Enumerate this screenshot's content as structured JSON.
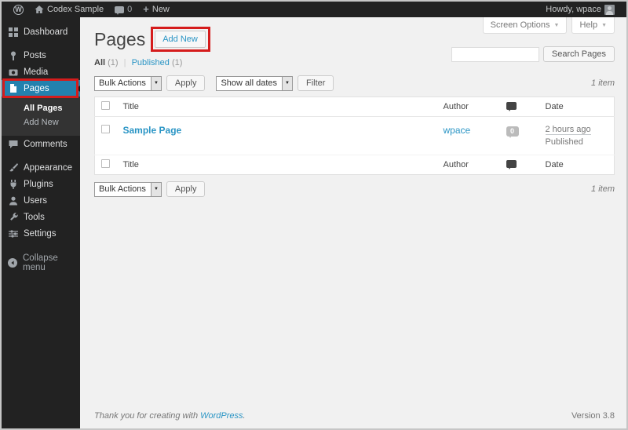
{
  "colors": {
    "accent_blue": "#2a95c5",
    "menu_active_bg": "#2381ae",
    "annotation_red": "#d51c1c",
    "admin_bar_bg": "#222222",
    "submenu_bg": "#333333",
    "content_bg": "#f1f1f1"
  },
  "admin_bar": {
    "site_name": "Codex Sample",
    "comment_count": "0",
    "new_label": "New",
    "greeting": "Howdy, wpace"
  },
  "sidebar": {
    "items": [
      {
        "label": "Dashboard"
      },
      {
        "label": "Posts"
      },
      {
        "label": "Media"
      },
      {
        "label": "Pages"
      },
      {
        "label": "Comments"
      },
      {
        "label": "Appearance"
      },
      {
        "label": "Plugins"
      },
      {
        "label": "Users"
      },
      {
        "label": "Tools"
      },
      {
        "label": "Settings"
      }
    ],
    "pages_submenu": {
      "all_pages": "All Pages",
      "add_new": "Add New"
    },
    "collapse_label": "Collapse menu"
  },
  "page_header": {
    "title": "Pages",
    "add_new_button": "Add New",
    "screen_options": "Screen Options",
    "help": "Help"
  },
  "filters": {
    "all": "All",
    "all_count": "(1)",
    "separator": "|",
    "published": "Published",
    "published_count": "(1)"
  },
  "search": {
    "value": "",
    "button": "Search Pages"
  },
  "toolbar_top": {
    "bulk_actions": "Bulk Actions",
    "apply": "Apply",
    "dates": "Show all dates",
    "filter": "Filter",
    "count": "1 item"
  },
  "toolbar_bottom": {
    "bulk_actions": "Bulk Actions",
    "apply": "Apply",
    "count": "1 item"
  },
  "table": {
    "columns": {
      "title": "Title",
      "author": "Author",
      "date": "Date"
    },
    "rows": [
      {
        "title": "Sample Page",
        "author": "wpace",
        "comment_count": "0",
        "date": "2 hours ago",
        "status": "Published"
      }
    ]
  },
  "footer": {
    "thanks": "Thank you for creating with",
    "wordpress": "WordPress",
    "period": ".",
    "version": "Version 3.8"
  },
  "icons": {
    "wordpress-logo": "W",
    "new-icon": "+",
    "dropdown-arrow": "▼",
    "meta-caret": "▼",
    "home-icon": "house",
    "comment-icon": "speech-bubble",
    "collapse-icon": "left-arrow-circle"
  }
}
